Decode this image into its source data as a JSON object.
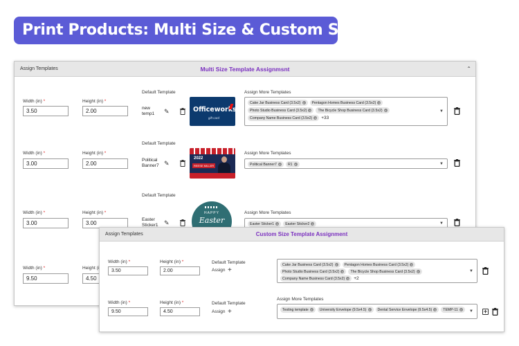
{
  "banner": {
    "title": "Print Products: Multi Size & Custom Size"
  },
  "multi": {
    "header_left": "Assign Templates",
    "header_title": "Multi Size Template Assignmsnt",
    "width_label": "Width (in)",
    "height_label": "Height (in)",
    "required": "*",
    "default_template_label": "Default Template",
    "assign_more_label": "Assign More Templates",
    "rows": [
      {
        "width": "3.50",
        "height": "2.00",
        "template_name": "new temp1",
        "thumb_brand": "Officeworks",
        "thumb_sub": "gift card",
        "chips": [
          "Cake Jar Business Card (3.5x2)",
          "Pentagon Homes Business Card (3.5x2)",
          "Photo Studio Business Card (3.5x2)",
          "The Bicycle Shop Business Card (3.5x2)",
          "Company Name Business Card (3.5x2)"
        ],
        "more": "+33"
      },
      {
        "width": "3.00",
        "height": "2.00",
        "template_name": "Political Banner7",
        "thumb_year": "2022",
        "thumb_name": "REESE MILLER",
        "chips": [
          "Political Banner7",
          "R1"
        ],
        "more": ""
      },
      {
        "width": "3.00",
        "height": "3.00",
        "template_name": "Easter Sticker1",
        "thumb_line1": "HAPPY",
        "thumb_line2": "Easter",
        "chips": [
          "Easter Sticker1",
          "Easter Sticker2"
        ],
        "more": ""
      },
      {
        "width": "9.50",
        "height": "4.50"
      }
    ]
  },
  "custom": {
    "header_left": "Assign Templates",
    "header_title": "Custom Size Template Assignment",
    "width_label": "Width (in)",
    "height_label": "Height (in)",
    "required": "*",
    "default_template_label": "Default Template",
    "assign_label": "Assign",
    "assign_more_label": "Assign More Templates",
    "rows": [
      {
        "width": "3.50",
        "height": "2.00",
        "chips": [
          "Cake Jar Business Card (3.5x2)",
          "Pentagon Homes Business Card (3.5x2)",
          "Photo Studio Business Card (3.5x2)",
          "The Bicycle Shop Business Card (3.5x2)",
          "Company Name Business Card (3.5x2)"
        ],
        "more": "+2"
      },
      {
        "width": "9.50",
        "height": "4.50",
        "chips": [
          "Testing template",
          "University Envelope (9.5x4.5)",
          "Dental Service Envelope (9.5x4.5)",
          "TEMP-11"
        ],
        "more": ""
      }
    ]
  }
}
